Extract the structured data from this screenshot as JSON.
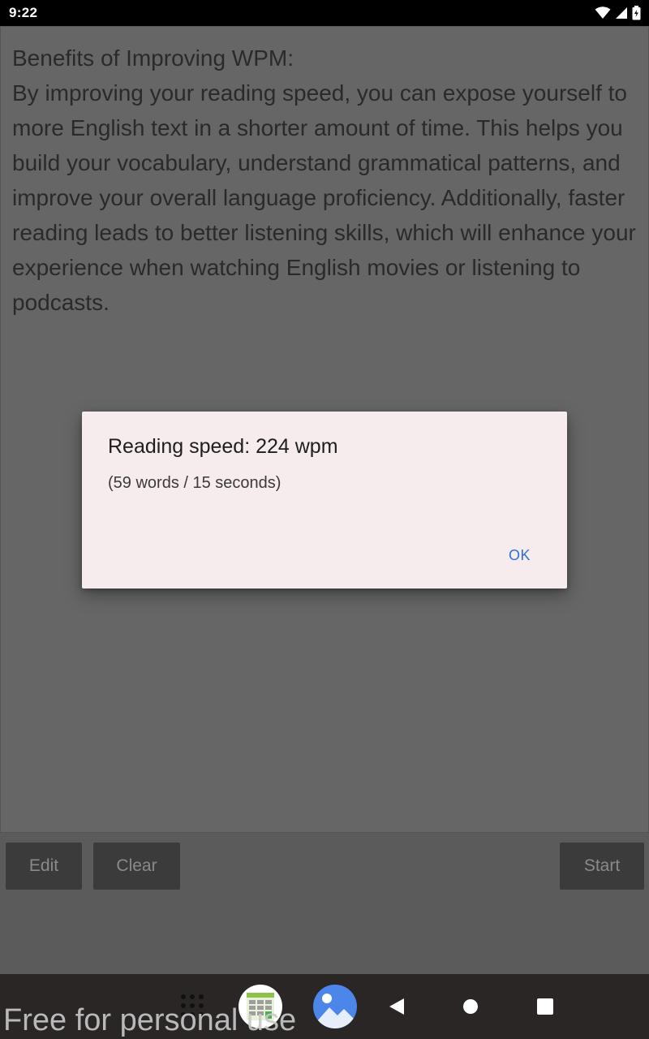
{
  "status_bar": {
    "time": "9:22",
    "icons": [
      "wifi-icon",
      "signal-icon",
      "battery-icon"
    ]
  },
  "content": {
    "title": "Benefits of Improving WPM:",
    "body": "By improving your reading speed, you can expose yourself to more English text in a shorter amount of time. This helps you build your vocabulary, understand grammatical patterns, and improve your overall language proficiency. Additionally, faster reading leads to better listening skills, which will enhance your experience when watching English movies or listening to podcasts."
  },
  "controls": {
    "edit_label": "Edit",
    "clear_label": "Clear",
    "start_label": "Start"
  },
  "dialog": {
    "title": "Reading speed: 224 wpm",
    "message": "(59 words / 15 seconds)",
    "ok_label": "OK"
  },
  "nav_bar": {
    "items": [
      "apps-grid-icon",
      "calculator-app-icon",
      "gallery-app-icon",
      "back-icon",
      "home-icon",
      "recents-icon"
    ]
  },
  "watermark": "Free for personal use",
  "colors": {
    "accent": "#2e6fd9",
    "dialog_bg": "#f7eced",
    "scrim_bg": "#5b5b5b"
  }
}
